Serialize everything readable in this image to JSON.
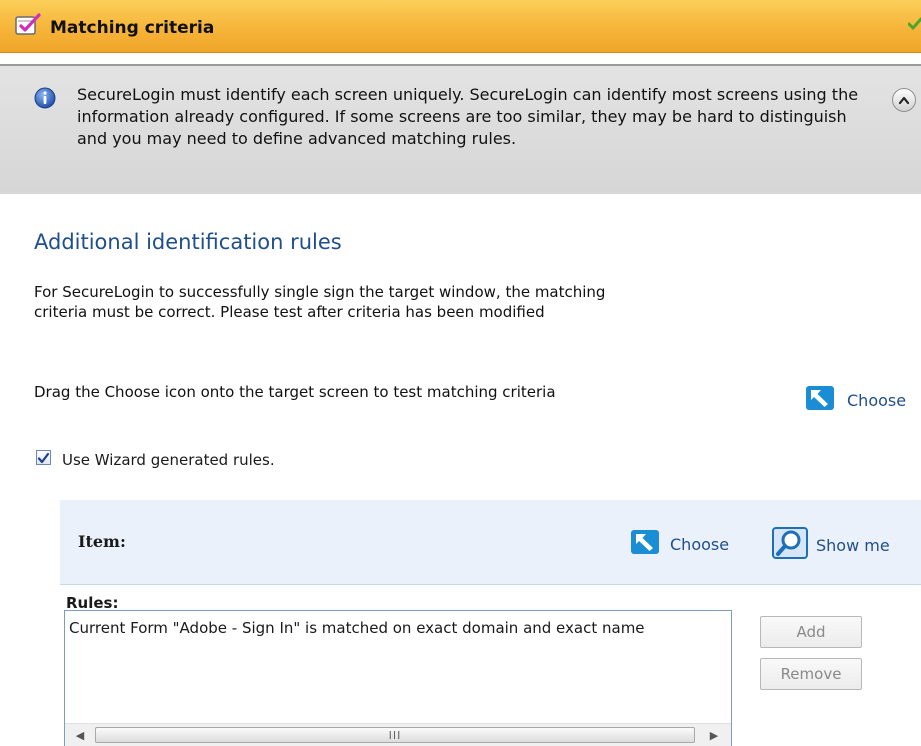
{
  "header": {
    "title": "Matching criteria"
  },
  "info": {
    "text": "SecureLogin must identify each screen uniquely. SecureLogin can identify most screens using the information already configured. If some screens are too similar, they may be hard to distinguish and you may need to define advanced matching rules."
  },
  "section": {
    "title": "Additional identification rules",
    "para1": "For SecureLogin to successfully single sign the target window, the matching criteria must be correct. Please test after criteria has been modified",
    "para2": "Drag the Choose icon onto the target screen to test matching criteria",
    "choose_label": "Choose",
    "checkbox_label": "Use Wizard generated rules.",
    "checkbox_checked": true
  },
  "item": {
    "label": "Item:",
    "choose_label": "Choose",
    "show_me_label": "Show me"
  },
  "rules": {
    "title": "Rules:",
    "items": [
      "Current Form \"Adobe - Sign In\" is matched on exact domain and exact name"
    ],
    "add_label": "Add",
    "remove_label": "Remove",
    "scroll_thumb_grip": "III"
  },
  "icons": {
    "header": "checklist-icon",
    "info": "info-icon",
    "collapse": "chevron-up-icon",
    "choose": "choose-arrow-icon",
    "show_me": "magnifier-icon",
    "header_status": "green-check-icon"
  },
  "colors": {
    "header_gradient_top": "#fbcf58",
    "header_gradient_bottom": "#f0a629",
    "link_blue": "#1f4e8c",
    "info_bg": "#dcdcdc",
    "item_panel_bg": "#eaf1fb"
  }
}
